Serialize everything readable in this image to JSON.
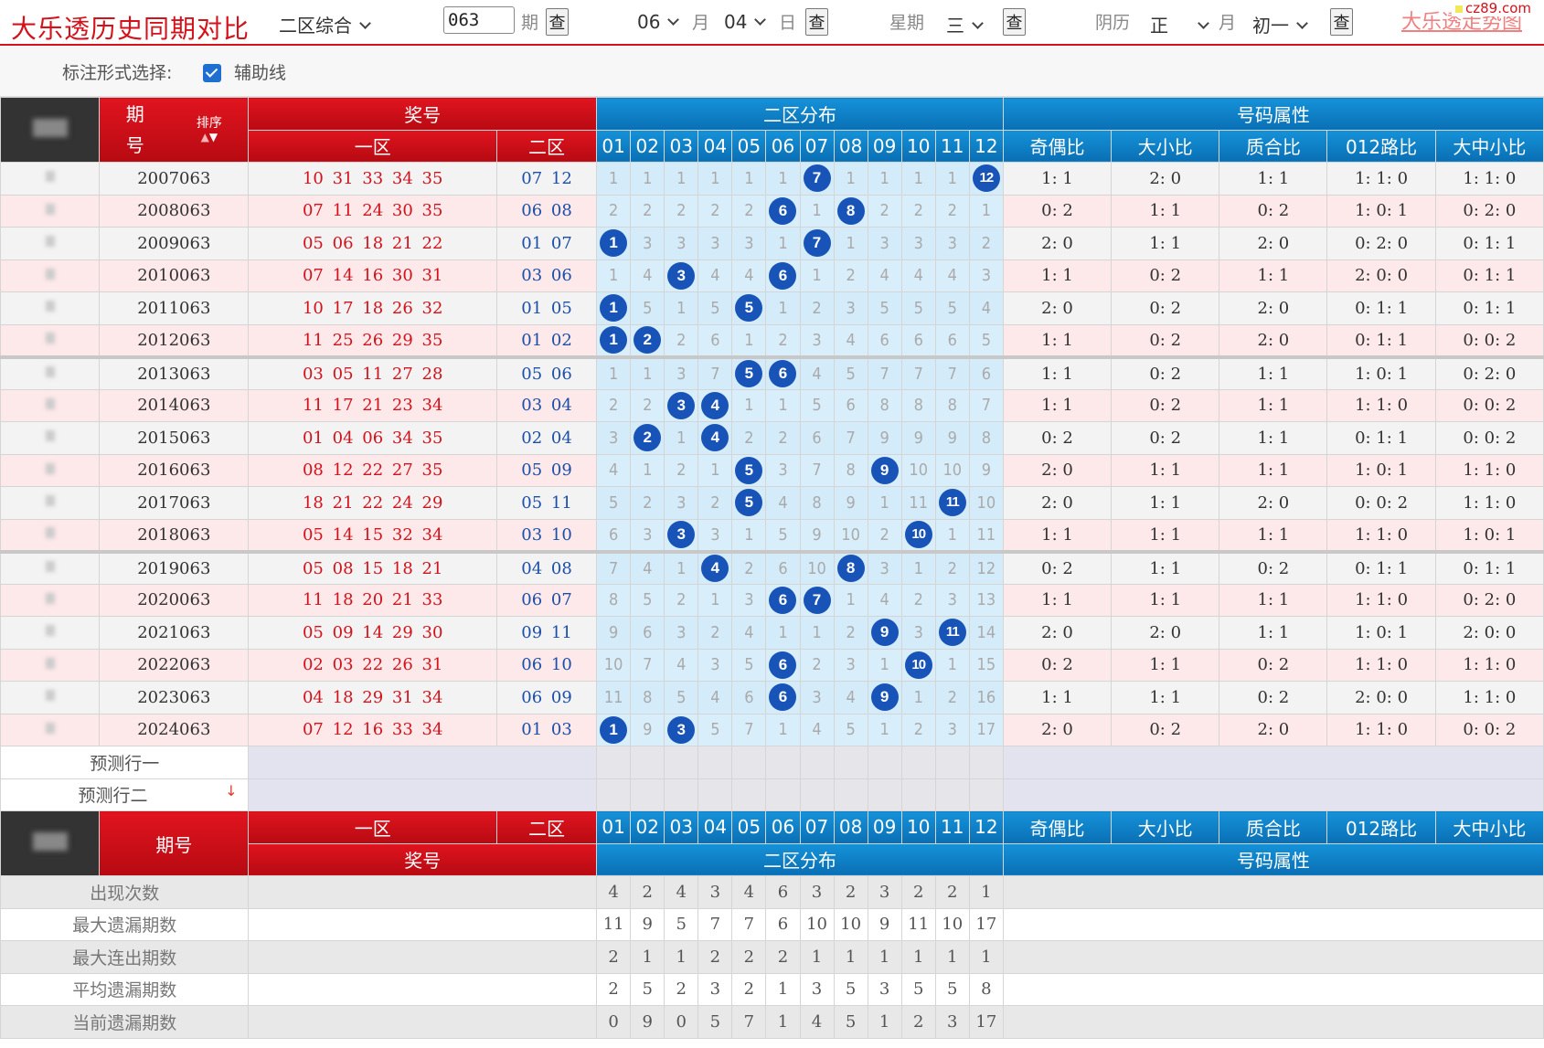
{
  "topbar": {
    "title": "大乐透历史同期对比",
    "zone_select": "二区综合",
    "issue_value": "063",
    "issue_suffix": "期",
    "query": "查",
    "month_value": "06",
    "month_suffix": "月",
    "day_value": "04",
    "day_suffix": "日",
    "week_label": "星期",
    "week_value": "三",
    "lunar_label": "阴历",
    "lunar_month": "正",
    "lunar_month_suffix": "月",
    "lunar_day": "初一",
    "link": "大乐透走势图",
    "watermark": "cz89.com"
  },
  "options": {
    "label": "标注形式选择:",
    "checkbox_label": "辅助线",
    "checked": true
  },
  "header": {
    "issue": "期号",
    "issue_top": "期",
    "issue_bottom": "号",
    "sort": "排序",
    "prize": "奖号",
    "zone1": "一区",
    "zone2": "二区",
    "dist": "二区分布",
    "attrs": "号码属性",
    "cols": [
      "01",
      "02",
      "03",
      "04",
      "05",
      "06",
      "07",
      "08",
      "09",
      "10",
      "11",
      "12"
    ],
    "attr_cols": [
      "奇偶比",
      "大小比",
      "质合比",
      "012路比",
      "大中小比"
    ]
  },
  "rows": [
    {
      "issue": "2007063",
      "z1": "10 31 33 34 35",
      "z2": "07 12",
      "dist": [
        "1",
        "1",
        "1",
        "1",
        "1",
        "1",
        "7",
        "1",
        "1",
        "1",
        "1",
        "12"
      ],
      "hits": [
        6,
        11
      ],
      "attrs": [
        "1: 1",
        "2: 0",
        "1: 1",
        "1: 1: 0",
        "1: 1: 0"
      ]
    },
    {
      "issue": "2008063",
      "z1": "07 11 24 30 35",
      "z2": "06 08",
      "dist": [
        "2",
        "2",
        "2",
        "2",
        "2",
        "6",
        "1",
        "8",
        "2",
        "2",
        "2",
        "1"
      ],
      "hits": [
        5,
        7
      ],
      "attrs": [
        "0: 2",
        "1: 1",
        "0: 2",
        "1: 0: 1",
        "0: 2: 0"
      ]
    },
    {
      "issue": "2009063",
      "z1": "05 06 18 21 22",
      "z2": "01 07",
      "dist": [
        "1",
        "3",
        "3",
        "3",
        "3",
        "1",
        "7",
        "1",
        "3",
        "3",
        "3",
        "2"
      ],
      "hits": [
        0,
        6
      ],
      "attrs": [
        "2: 0",
        "1: 1",
        "2: 0",
        "0: 2: 0",
        "0: 1: 1"
      ]
    },
    {
      "issue": "2010063",
      "z1": "07 14 16 30 31",
      "z2": "03 06",
      "dist": [
        "1",
        "4",
        "3",
        "4",
        "4",
        "6",
        "1",
        "2",
        "4",
        "4",
        "4",
        "3"
      ],
      "hits": [
        2,
        5
      ],
      "attrs": [
        "1: 1",
        "0: 2",
        "1: 1",
        "2: 0: 0",
        "0: 1: 1"
      ]
    },
    {
      "issue": "2011063",
      "z1": "10 17 18 26 32",
      "z2": "01 05",
      "dist": [
        "1",
        "5",
        "1",
        "5",
        "5",
        "1",
        "2",
        "3",
        "5",
        "5",
        "5",
        "4"
      ],
      "hits": [
        0,
        4
      ],
      "attrs": [
        "2: 0",
        "0: 2",
        "2: 0",
        "0: 1: 1",
        "0: 1: 1"
      ]
    },
    {
      "issue": "2012063",
      "z1": "11 25 26 29 35",
      "z2": "01 02",
      "dist": [
        "1",
        "2",
        "2",
        "6",
        "1",
        "2",
        "3",
        "4",
        "6",
        "6",
        "6",
        "5"
      ],
      "hits": [
        0,
        1
      ],
      "attrs": [
        "1: 1",
        "0: 2",
        "2: 0",
        "0: 1: 1",
        "0: 0: 2"
      ]
    },
    {
      "issue": "2013063",
      "z1": "03 05 11 27 28",
      "z2": "05 06",
      "dist": [
        "1",
        "1",
        "3",
        "7",
        "5",
        "6",
        "4",
        "5",
        "7",
        "7",
        "7",
        "6"
      ],
      "hits": [
        4,
        5
      ],
      "attrs": [
        "1: 1",
        "0: 2",
        "1: 1",
        "1: 0: 1",
        "0: 2: 0"
      ]
    },
    {
      "issue": "2014063",
      "z1": "11 17 21 23 34",
      "z2": "03 04",
      "dist": [
        "2",
        "2",
        "3",
        "4",
        "1",
        "1",
        "5",
        "6",
        "8",
        "8",
        "8",
        "7"
      ],
      "hits": [
        2,
        3
      ],
      "attrs": [
        "1: 1",
        "0: 2",
        "1: 1",
        "1: 1: 0",
        "0: 0: 2"
      ]
    },
    {
      "issue": "2015063",
      "z1": "01 04 06 34 35",
      "z2": "02 04",
      "dist": [
        "3",
        "2",
        "1",
        "4",
        "2",
        "2",
        "6",
        "7",
        "9",
        "9",
        "9",
        "8"
      ],
      "hits": [
        1,
        3
      ],
      "attrs": [
        "0: 2",
        "0: 2",
        "1: 1",
        "0: 1: 1",
        "0: 0: 2"
      ]
    },
    {
      "issue": "2016063",
      "z1": "08 12 22 27 35",
      "z2": "05 09",
      "dist": [
        "4",
        "1",
        "2",
        "1",
        "5",
        "3",
        "7",
        "8",
        "9",
        "10",
        "10",
        "9"
      ],
      "hits": [
        4,
        8
      ],
      "attrs": [
        "2: 0",
        "1: 1",
        "1: 1",
        "1: 0: 1",
        "1: 1: 0"
      ]
    },
    {
      "issue": "2017063",
      "z1": "18 21 22 24 29",
      "z2": "05 11",
      "dist": [
        "5",
        "2",
        "3",
        "2",
        "5",
        "4",
        "8",
        "9",
        "1",
        "11",
        "11",
        "10"
      ],
      "hits": [
        4,
        10
      ],
      "attrs": [
        "2: 0",
        "1: 1",
        "2: 0",
        "0: 0: 2",
        "1: 1: 0"
      ]
    },
    {
      "issue": "2018063",
      "z1": "05 14 15 32 34",
      "z2": "03 10",
      "dist": [
        "6",
        "3",
        "3",
        "3",
        "1",
        "5",
        "9",
        "10",
        "2",
        "10",
        "1",
        "11"
      ],
      "hits": [
        2,
        9
      ],
      "attrs": [
        "1: 1",
        "1: 1",
        "1: 1",
        "1: 1: 0",
        "1: 0: 1"
      ]
    },
    {
      "issue": "2019063",
      "z1": "05 08 15 18 21",
      "z2": "04 08",
      "dist": [
        "7",
        "4",
        "1",
        "4",
        "2",
        "6",
        "10",
        "8",
        "3",
        "1",
        "2",
        "12"
      ],
      "hits": [
        3,
        7
      ],
      "attrs": [
        "0: 2",
        "1: 1",
        "0: 2",
        "0: 1: 1",
        "0: 1: 1"
      ]
    },
    {
      "issue": "2020063",
      "z1": "11 18 20 21 33",
      "z2": "06 07",
      "dist": [
        "8",
        "5",
        "2",
        "1",
        "3",
        "6",
        "7",
        "1",
        "4",
        "2",
        "3",
        "13"
      ],
      "hits": [
        5,
        6
      ],
      "attrs": [
        "1: 1",
        "1: 1",
        "1: 1",
        "1: 1: 0",
        "0: 2: 0"
      ]
    },
    {
      "issue": "2021063",
      "z1": "05 09 14 29 30",
      "z2": "09 11",
      "dist": [
        "9",
        "6",
        "3",
        "2",
        "4",
        "1",
        "1",
        "2",
        "9",
        "3",
        "11",
        "14"
      ],
      "hits": [
        8,
        10
      ],
      "attrs": [
        "2: 0",
        "2: 0",
        "1: 1",
        "1: 0: 1",
        "2: 0: 0"
      ]
    },
    {
      "issue": "2022063",
      "z1": "02 03 22 26 31",
      "z2": "06 10",
      "dist": [
        "10",
        "7",
        "4",
        "3",
        "5",
        "6",
        "2",
        "3",
        "1",
        "10",
        "1",
        "15"
      ],
      "hits": [
        5,
        9
      ],
      "attrs": [
        "0: 2",
        "1: 1",
        "0: 2",
        "1: 1: 0",
        "1: 1: 0"
      ]
    },
    {
      "issue": "2023063",
      "z1": "04 18 29 31 34",
      "z2": "06 09",
      "dist": [
        "11",
        "8",
        "5",
        "4",
        "6",
        "6",
        "3",
        "4",
        "9",
        "1",
        "2",
        "16"
      ],
      "hits": [
        5,
        8
      ],
      "attrs": [
        "1: 1",
        "1: 1",
        "0: 2",
        "2: 0: 0",
        "1: 1: 0"
      ]
    },
    {
      "issue": "2024063",
      "z1": "07 12 16 33 34",
      "z2": "01 03",
      "dist": [
        "1",
        "9",
        "3",
        "5",
        "7",
        "1",
        "4",
        "5",
        "1",
        "2",
        "3",
        "17"
      ],
      "hits": [
        0,
        2
      ],
      "attrs": [
        "2: 0",
        "0: 2",
        "2: 0",
        "1: 1: 0",
        "0: 0: 2"
      ]
    }
  ],
  "predict": {
    "row1": "预测行一",
    "row2": "预测行二"
  },
  "stats": [
    {
      "label": "出现次数",
      "values": [
        "4",
        "2",
        "4",
        "3",
        "4",
        "6",
        "3",
        "2",
        "3",
        "2",
        "2",
        "1"
      ]
    },
    {
      "label": "最大遗漏期数",
      "values": [
        "11",
        "9",
        "5",
        "7",
        "7",
        "6",
        "10",
        "10",
        "9",
        "11",
        "10",
        "17"
      ]
    },
    {
      "label": "最大连出期数",
      "values": [
        "2",
        "1",
        "1",
        "2",
        "2",
        "2",
        "1",
        "1",
        "1",
        "1",
        "1",
        "1"
      ]
    },
    {
      "label": "平均遗漏期数",
      "values": [
        "2",
        "5",
        "2",
        "3",
        "2",
        "1",
        "3",
        "5",
        "3",
        "5",
        "5",
        "8"
      ]
    },
    {
      "label": "当前遗漏期数",
      "values": [
        "0",
        "9",
        "0",
        "5",
        "7",
        "1",
        "4",
        "5",
        "1",
        "2",
        "3",
        "17"
      ]
    }
  ],
  "colors": {
    "brand_red": "#d3121b",
    "blue_header": "#0a6fb4",
    "ball": "#1854b8"
  }
}
